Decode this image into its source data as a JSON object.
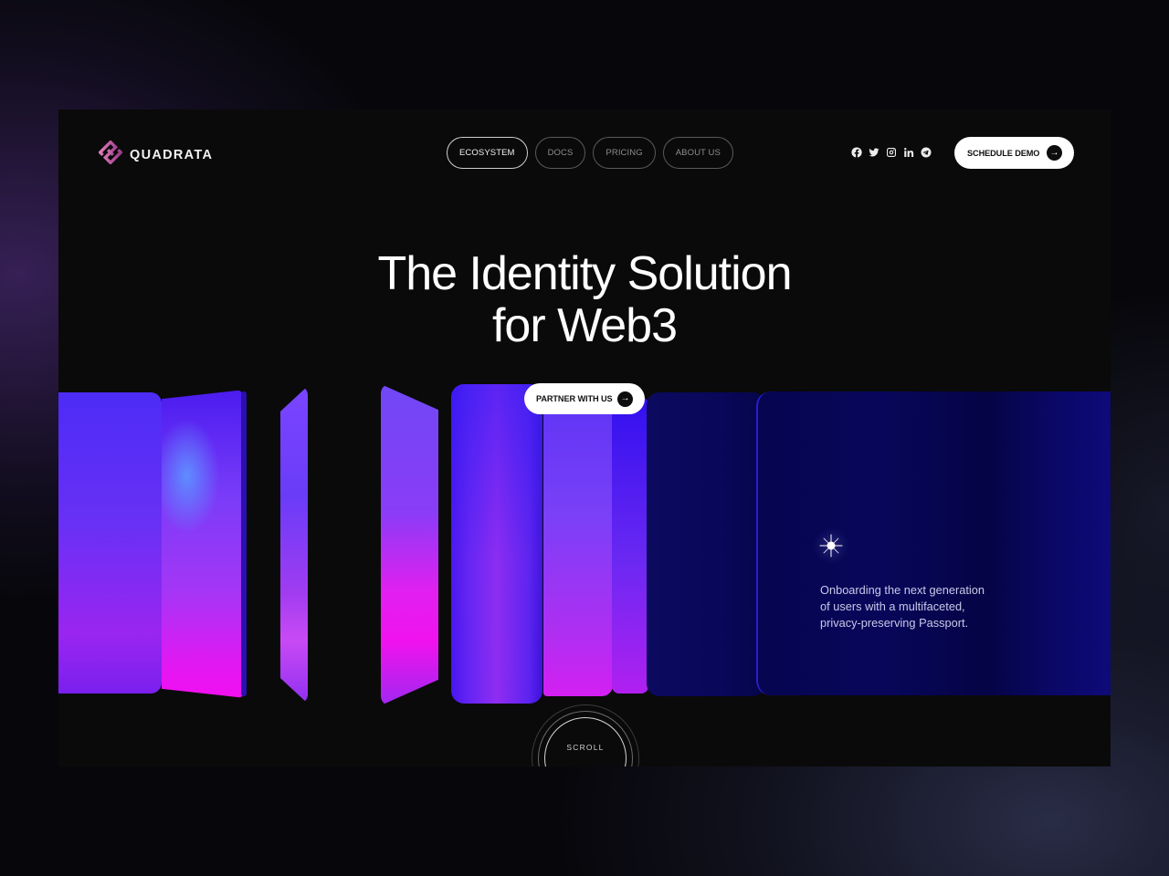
{
  "brand": {
    "name": "QUADRATA",
    "logo_icon": "quadrata-logo-icon",
    "accent": "#c05aa0"
  },
  "nav": {
    "items": [
      {
        "label": "ECOSYSTEM",
        "active": true
      },
      {
        "label": "DOCS",
        "active": false
      },
      {
        "label": "PRICING",
        "active": false
      },
      {
        "label": "ABOUT US",
        "active": false
      }
    ]
  },
  "social": [
    "facebook-icon",
    "twitter-icon",
    "instagram-icon",
    "linkedin-icon",
    "telegram-icon"
  ],
  "header": {
    "cta_label": "SCHEDULE DEMO",
    "cta_icon": "arrow-right-icon"
  },
  "hero": {
    "headline_line1": "The Identity Solution",
    "headline_line2": "for Web3",
    "cta_label": "PARTNER WITH US",
    "cta_icon": "arrow-right-icon",
    "tagline": "Onboarding the next generation of users with a multifaceted, privacy-preserving Passport.",
    "tagline_lines": [
      "Onboarding the next generation",
      "of users with a multifaceted,",
      "privacy-preserving Passport."
    ],
    "sparkle_icon": "sparkle-icon",
    "colors": {
      "panel_blue": "#4c2cf6",
      "panel_magenta": "#f012ee",
      "panel_navy": "#07065a"
    }
  },
  "scroll": {
    "label": "SCROLL"
  }
}
